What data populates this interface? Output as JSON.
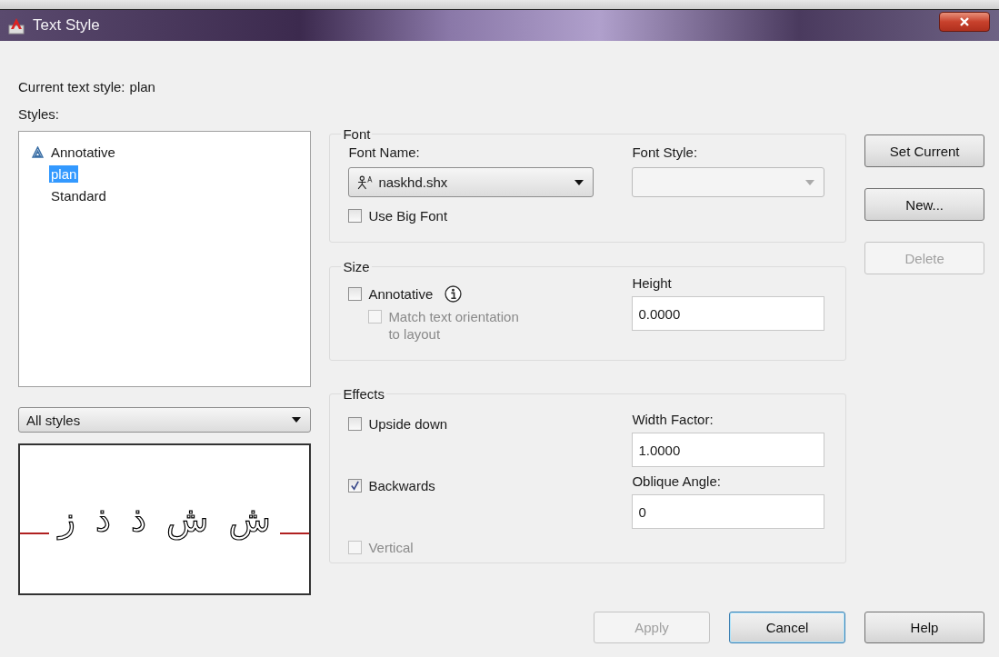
{
  "window": {
    "title": "Text Style"
  },
  "current_style": {
    "label": "Current text style:",
    "value": "plan"
  },
  "styles": {
    "label": "Styles:",
    "items": [
      {
        "name": "Annotative",
        "annotative": true,
        "selected": false
      },
      {
        "name": "plan",
        "annotative": false,
        "selected": true
      },
      {
        "name": "Standard",
        "annotative": false,
        "selected": false
      }
    ]
  },
  "filter": {
    "value": "All styles"
  },
  "preview": {
    "sample": "ش ش ذ ذ ز"
  },
  "font": {
    "title": "Font",
    "font_name": {
      "label": "Font Name:",
      "value": "naskhd.shx"
    },
    "font_style": {
      "label": "Font Style:",
      "disabled": true
    },
    "use_big_font": {
      "label": "Use Big Font",
      "checked": false,
      "disabled": false
    }
  },
  "size": {
    "title": "Size",
    "annotative": {
      "label": "Annotative",
      "checked": false,
      "disabled": false
    },
    "match_orientation": {
      "label": "Match text orientation to layout",
      "checked": false,
      "disabled": true
    },
    "height": {
      "label": "Height",
      "value": "0.0000"
    }
  },
  "effects": {
    "title": "Effects",
    "checkboxes": [
      {
        "label": "Upside down",
        "checked": false,
        "disabled": false
      },
      {
        "label": "Backwards",
        "checked": true,
        "disabled": false
      },
      {
        "label": "Vertical",
        "checked": false,
        "disabled": true
      }
    ],
    "width_factor": {
      "label": "Width Factor:",
      "value": "1.0000"
    },
    "oblique_angle": {
      "label": "Oblique Angle:",
      "value": "0"
    }
  },
  "side_buttons": [
    {
      "label": "Set Current",
      "disabled": false,
      "focused": false
    },
    {
      "label": "New...",
      "disabled": false,
      "focused": false
    },
    {
      "label": "Delete",
      "disabled": true,
      "focused": false
    }
  ],
  "bottom_buttons": [
    {
      "label": "Apply",
      "disabled": true,
      "focused": false
    },
    {
      "label": "Cancel",
      "disabled": false,
      "focused": true
    },
    {
      "label": "Help",
      "disabled": false,
      "focused": false
    }
  ]
}
